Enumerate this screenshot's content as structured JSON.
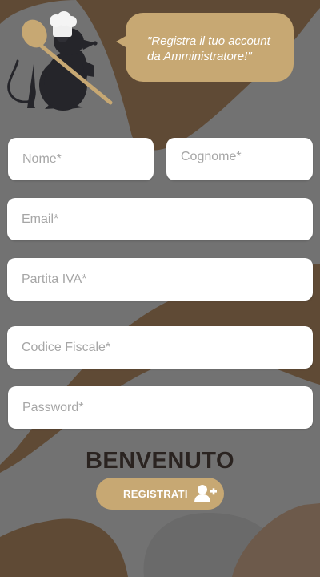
{
  "colors": {
    "background": "#5f4a35",
    "accent": "#c7a873",
    "swoosh": "#727272",
    "field": "#ffffff",
    "title_text": "#2a2320"
  },
  "mascot": {
    "icon": "rat-chef-with-spoon-icon"
  },
  "speech_bubble": {
    "text": "\"Registra il tuo account da Amministratore!\""
  },
  "form": {
    "nome_placeholder": "Nome*",
    "cognome_placeholder": "Cognome*",
    "email_placeholder": "Email*",
    "partita_iva_placeholder": "Partita IVA*",
    "codice_fiscale_placeholder": "Codice Fiscale*",
    "password_placeholder": "Password*"
  },
  "welcome_title": "BENVENUTO",
  "register_button": {
    "label": "REGISTRATI",
    "icon": "add-user-icon"
  }
}
